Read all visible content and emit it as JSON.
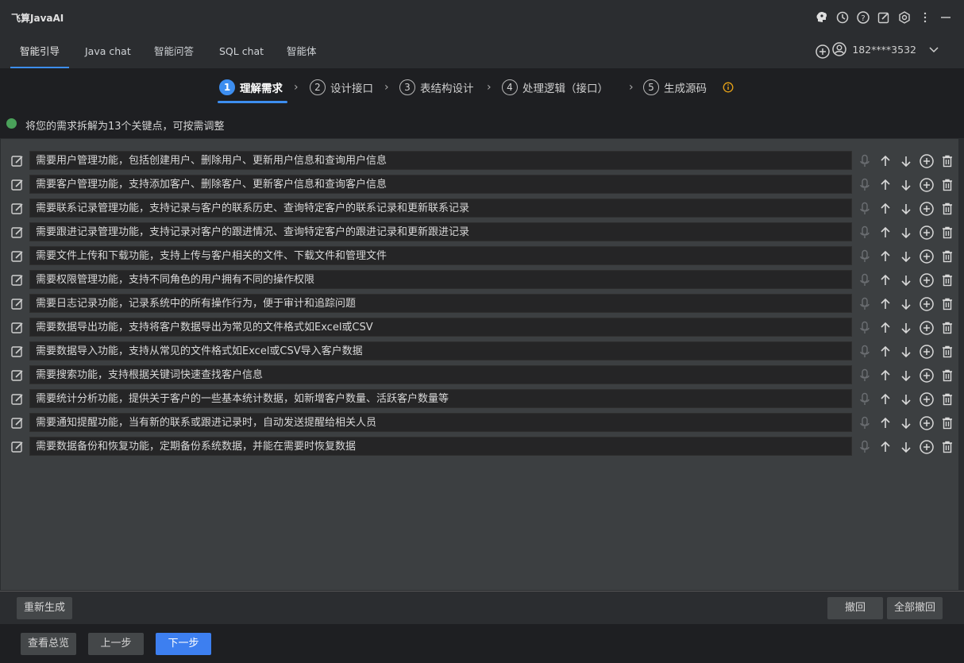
{
  "app": {
    "title": "飞算JavaAI"
  },
  "tabs": [
    {
      "label": "智能引导",
      "active": true
    },
    {
      "label": "Java chat"
    },
    {
      "label": "智能问答"
    },
    {
      "label": "SQL chat"
    },
    {
      "label": "智能体"
    }
  ],
  "user": {
    "name": "182****3532"
  },
  "steps": [
    {
      "num": "1",
      "label": "理解需求",
      "active": true
    },
    {
      "num": "2",
      "label": "设计接口"
    },
    {
      "num": "3",
      "label": "表结构设计"
    },
    {
      "num": "4",
      "label": "处理逻辑（接口）"
    },
    {
      "num": "5",
      "label": "生成源码"
    }
  ],
  "notice": {
    "text": "将您的需求拆解为13个关键点，可按需调整"
  },
  "requirements": [
    "需要用户管理功能，包括创建用户、删除用户、更新用户信息和查询用户信息",
    "需要客户管理功能，支持添加客户、删除客户、更新客户信息和查询客户信息",
    "需要联系记录管理功能，支持记录与客户的联系历史、查询特定客户的联系记录和更新联系记录",
    "需要跟进记录管理功能，支持记录对客户的跟进情况、查询特定客户的跟进记录和更新跟进记录",
    "需要文件上传和下载功能，支持上传与客户相关的文件、下载文件和管理文件",
    "需要权限管理功能，支持不同角色的用户拥有不同的操作权限",
    "需要日志记录功能，记录系统中的所有操作行为，便于审计和追踪问题",
    "需要数据导出功能，支持将客户数据导出为常见的文件格式如Excel或CSV",
    "需要数据导入功能，支持从常见的文件格式如Excel或CSV导入客户数据",
    "需要搜索功能，支持根据关键词快速查找客户信息",
    "需要统计分析功能，提供关于客户的一些基本统计数据，如新增客户数量、活跃客户数量等",
    "需要通知提醒功能，当有新的联系或跟进记录时，自动发送提醒给相关人员",
    "需要数据备份和恢复功能，定期备份系统数据，并能在需要时恢复数据"
  ],
  "actions": {
    "regenerate": "重新生成",
    "undo": "撤回",
    "undo_all": "全部撤回"
  },
  "footer": {
    "overview": "查看总览",
    "prev": "上一步",
    "next": "下一步"
  },
  "colors": {
    "accent": "#3d8ef0",
    "success": "#4aa15a",
    "warning": "#e8a317"
  }
}
